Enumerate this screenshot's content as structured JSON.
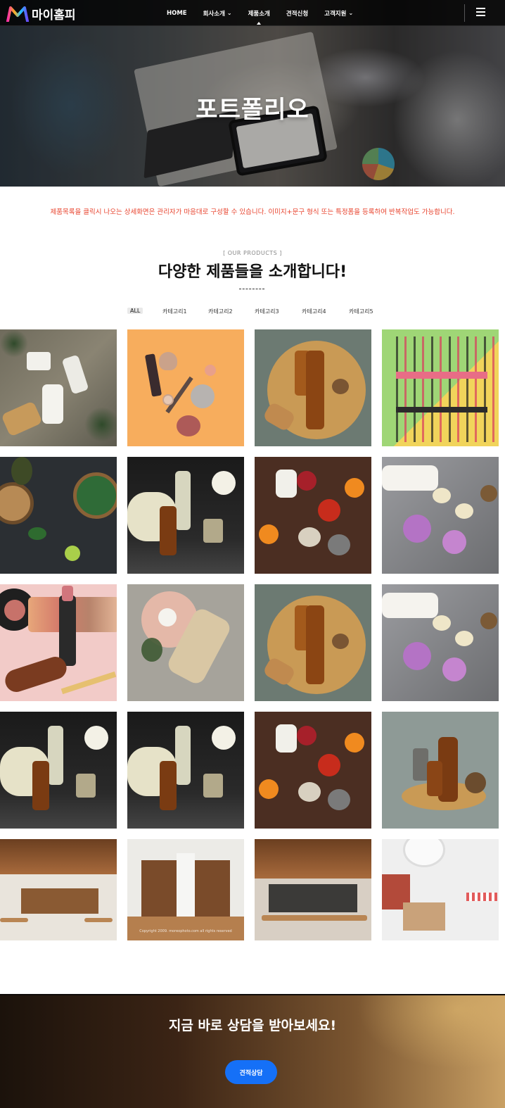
{
  "header": {
    "logo_text": "마이홈피",
    "nav": [
      {
        "label": "HOME",
        "dropdown": false,
        "active": false
      },
      {
        "label": "회사소개",
        "dropdown": true,
        "active": false
      },
      {
        "label": "제품소개",
        "dropdown": false,
        "active": true
      },
      {
        "label": "견적신청",
        "dropdown": false,
        "active": false
      },
      {
        "label": "고객지원",
        "dropdown": true,
        "active": false
      }
    ],
    "menu_icon": "hamburger-icon"
  },
  "hero": {
    "title": "포트폴리오"
  },
  "notice": "제품목록을 클릭시 나오는 상세화면은 관리자가 마음대로 구성할 수 있습니다. 이미지+문구 형식 또는 특정폼을 등록하여 반복작업도 가능합니다.",
  "products": {
    "eyebrow": "[ OUR PRODUCTS ]",
    "title": "다양한 제품들을 소개합니다!",
    "filters": [
      "ALL",
      "카테고리1",
      "카테고리2",
      "카테고리3",
      "카테고리4",
      "카테고리5"
    ],
    "active_filter": "ALL",
    "captions": {
      "copyright": "Copyright 2009. moreophoto.com all rights reserved"
    }
  },
  "cta": {
    "title": "지금 바로 상담을 받아보세요!",
    "button": "견적상담"
  },
  "colors": {
    "notice": "#e8422c",
    "cta_button": "#1570f7"
  }
}
